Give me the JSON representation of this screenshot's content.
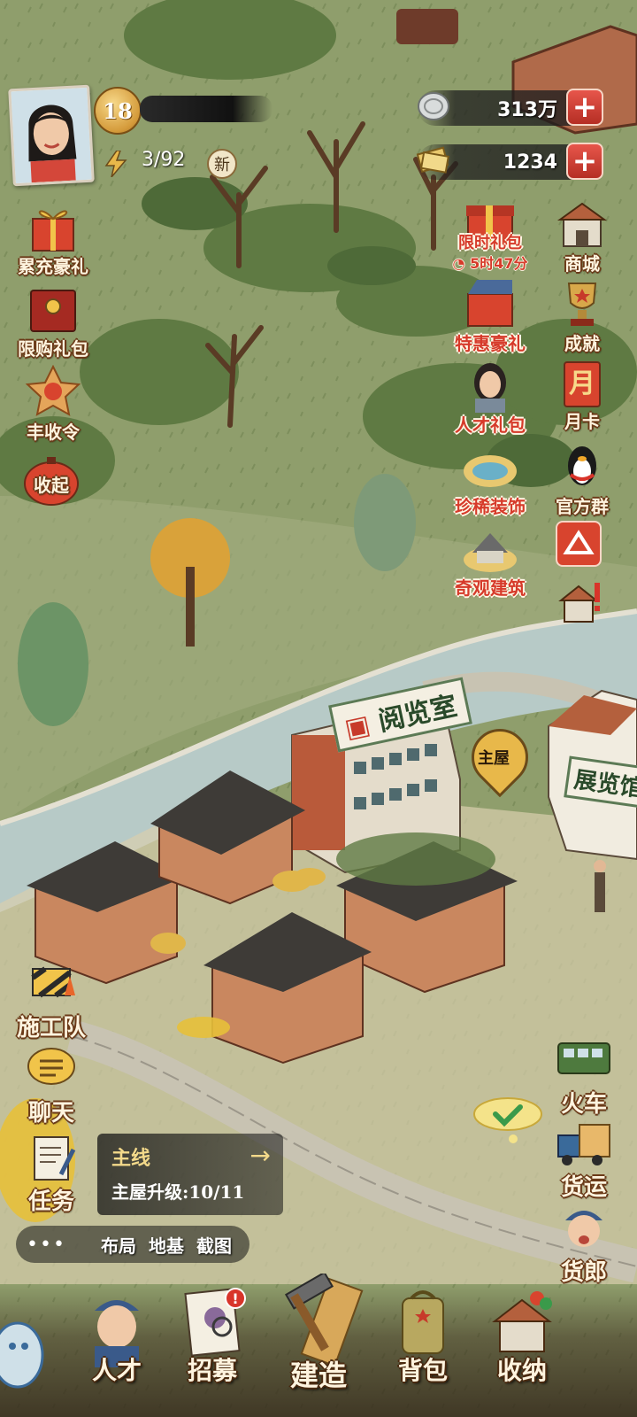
{
  "player": {
    "level": "18",
    "progress": "3/92",
    "new_badge": "新"
  },
  "resources": {
    "silver": "313万",
    "tickets": "1234",
    "plus_symbol": "+"
  },
  "left_menu": {
    "recharge_gift": "累充豪礼",
    "limited_pack": "限购礼包",
    "harvest_order": "丰收令",
    "collapse": "收起"
  },
  "right_menu": {
    "limited_gift": "限时礼包",
    "limited_gift_timer": "5时47分",
    "shop": "商城",
    "special_gift": "特惠豪礼",
    "achievement": "成就",
    "talent_pack": "人才礼包",
    "monthly_card": "月卡",
    "monthly_card_icon_char": "月",
    "rare_decor": "珍稀装饰",
    "official_group": "官方群",
    "wonder_building": "奇观建筑"
  },
  "side_actions": {
    "construction_team": "施工队",
    "chat": "聊天",
    "task": "任务",
    "train": "火车",
    "freight": "货运",
    "peddler": "货郎"
  },
  "quest": {
    "title": "主线",
    "arrow": "→",
    "desc": "主屋升级:10/11"
  },
  "quick_links": {
    "more": "•••",
    "layout": "布局",
    "foundation": "地基",
    "screenshot": "截图"
  },
  "map_labels": {
    "reading_room": "阅览室",
    "main_house": "主屋",
    "exhibition": "展览馆"
  },
  "bottom_nav": {
    "talent": "人才",
    "recruit": "招募",
    "recruit_alert": "!",
    "build": "建造",
    "backpack": "背包",
    "storage": "收纳"
  },
  "colors": {
    "grass": "#8a9a6a",
    "river": "#b7cac7",
    "accent_red": "#d63a2a",
    "gold": "#e8b84a"
  }
}
